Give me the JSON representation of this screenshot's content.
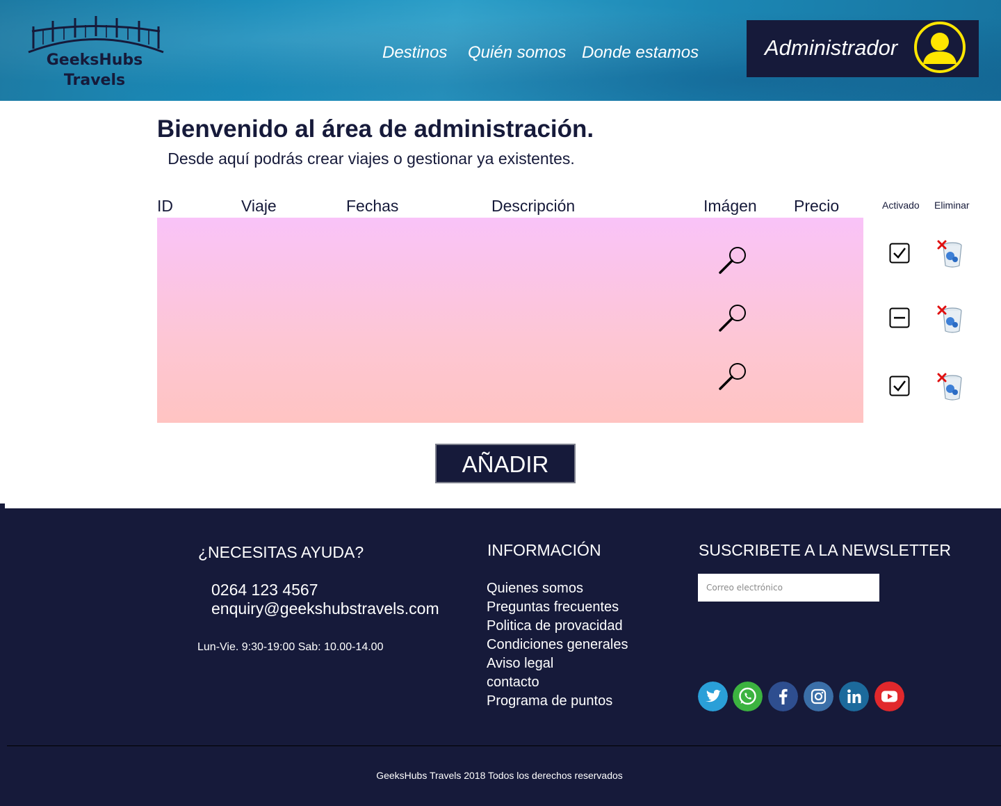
{
  "brand": {
    "line1": "GeeksHubs",
    "line2": "Travels"
  },
  "nav": {
    "items": [
      "Destinos",
      "Quién somos",
      "Donde estamos"
    ]
  },
  "user": {
    "label": "Administrador",
    "avatar_icon": "user-avatar-icon"
  },
  "main": {
    "title": "Bienvenido al área de administración.",
    "subtitle": "Desde aquí podrás crear viajes o gestionar ya existentes."
  },
  "table": {
    "headers": [
      "ID",
      "Viaje",
      "Fechas",
      "Descripción",
      "Imágen",
      "Precio",
      "Activado",
      "Eliminar"
    ],
    "rows": [
      {
        "image_icon": "magnifier-icon",
        "activado": "checked",
        "delete_icon": "trash-icon"
      },
      {
        "image_icon": "magnifier-icon",
        "activado": "indeterminate",
        "delete_icon": "trash-icon"
      },
      {
        "image_icon": "magnifier-icon",
        "activado": "checked",
        "delete_icon": "trash-icon"
      }
    ]
  },
  "actions": {
    "add_label": "AÑADIR"
  },
  "footer": {
    "help": {
      "heading": "¿NECESITAS AYUDA?",
      "phone": "0264 123 4567",
      "email": "enquiry@geekshubstravels.com",
      "hours": "Lun-Vie. 9:30-19:00 Sab: 10.00-14.00"
    },
    "info": {
      "heading": "INFORMACIÓN",
      "links": [
        "Quienes somos",
        "Preguntas frecuentes",
        "Politica de provacidad",
        "Condiciones generales",
        "Aviso legal",
        "contacto",
        "Programa de puntos"
      ]
    },
    "newsletter": {
      "heading": "SUSCRIBETE A LA NEWSLETTER",
      "placeholder": "Correo electrónico"
    },
    "social": [
      "twitter-icon",
      "whatsapp-icon",
      "facebook-icon",
      "instagram-icon",
      "linkedin-icon",
      "youtube-icon"
    ],
    "copyright": "GeeksHubs Travels 2018 Todos los derechos reservados"
  },
  "colors": {
    "navy": "#161a3a",
    "header_blue": "#1a8dbb",
    "avatar_yellow": "#ffe600",
    "table_top": "#f9c3f8",
    "table_bottom": "#ffc4c2"
  }
}
